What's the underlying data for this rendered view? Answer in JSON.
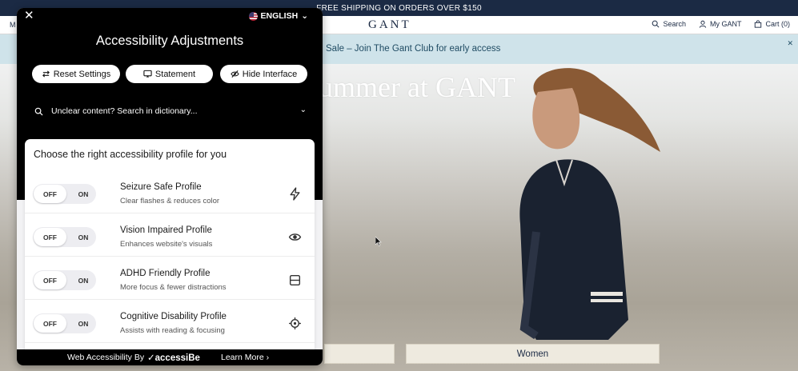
{
  "site": {
    "shipping_banner": "FREE SHIPPING ON ORDERS OVER $150",
    "logo": "GANT",
    "header_left": "M",
    "nav": {
      "search": "Search",
      "account": "My GANT",
      "cart": "Cart (0)"
    },
    "promo": "Sale – Join The Gant Club for early access",
    "promo_close": "✕",
    "hero_headline": "ummer at GANT",
    "hero_buttons": {
      "women": "Women"
    }
  },
  "panel": {
    "close": "✕",
    "language": "ENGLISH",
    "title": "Accessibility Adjustments",
    "buttons": {
      "reset": "Reset Settings",
      "statement": "Statement",
      "hide": "Hide Interface"
    },
    "dictionary": {
      "placeholder": "Unclear content? Search in dictionary...",
      "chevron": "⌄"
    },
    "profiles_title": "Choose the right accessibility profile for you",
    "profiles": [
      {
        "title": "Seizure Safe Profile",
        "subtitle": "Clear flashes & reduces color",
        "off": "OFF",
        "on": "ON",
        "icon": "lightning-icon"
      },
      {
        "title": "Vision Impaired Profile",
        "subtitle": "Enhances website's visuals",
        "off": "OFF",
        "on": "ON",
        "icon": "eye-icon"
      },
      {
        "title": "ADHD Friendly Profile",
        "subtitle": "More focus & fewer distractions",
        "off": "OFF",
        "on": "ON",
        "icon": "focus-frame-icon"
      },
      {
        "title": "Cognitive Disability Profile",
        "subtitle": "Assists with reading & focusing",
        "off": "OFF",
        "on": "ON",
        "icon": "target-icon"
      }
    ],
    "footer": {
      "text": "Web Accessibility By",
      "brand": "accessiBe",
      "learn_more": "Learn More ›"
    }
  },
  "colors": {
    "topbar": "#1b2a44",
    "promo_bg": "#cfe3ea",
    "panel_head": "#000000",
    "card_bg": "#ffffff"
  }
}
